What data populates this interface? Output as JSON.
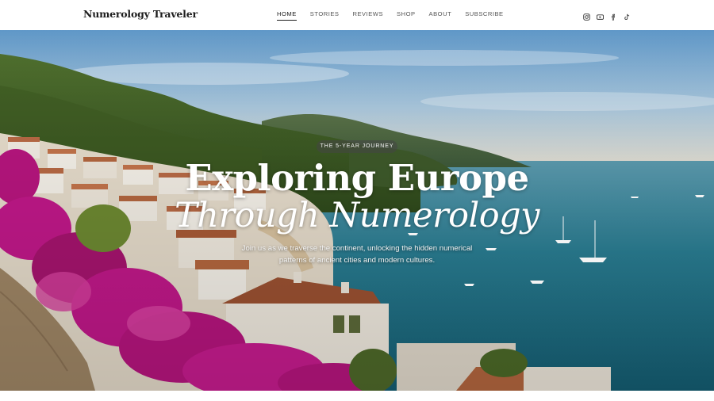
{
  "header": {
    "brand": "Numerology Traveler",
    "nav": [
      {
        "label": "HOME",
        "active": true
      },
      {
        "label": "STORIES",
        "active": false
      },
      {
        "label": "REVIEWS",
        "active": false
      },
      {
        "label": "SHOP",
        "active": false
      },
      {
        "label": "ABOUT",
        "active": false
      },
      {
        "label": "SUBSCRIBE",
        "active": false
      }
    ],
    "social_icons": [
      "instagram-icon",
      "youtube-icon",
      "facebook-icon",
      "tiktok-icon"
    ]
  },
  "hero": {
    "badge": "THE 5-YEAR JOURNEY",
    "title_line1": "Exploring Europe",
    "title_line2": "Through Numerology",
    "subtitle": "Join us as we traverse the continent, unlocking the hidden numerical patterns of ancient cities and modern cultures."
  },
  "colors": {
    "text_dark": "#1d1d1d",
    "nav_text": "#555555",
    "hero_title": "#ffffff",
    "sea": "#1f6f86",
    "bougainvillea": "#c2188a"
  }
}
